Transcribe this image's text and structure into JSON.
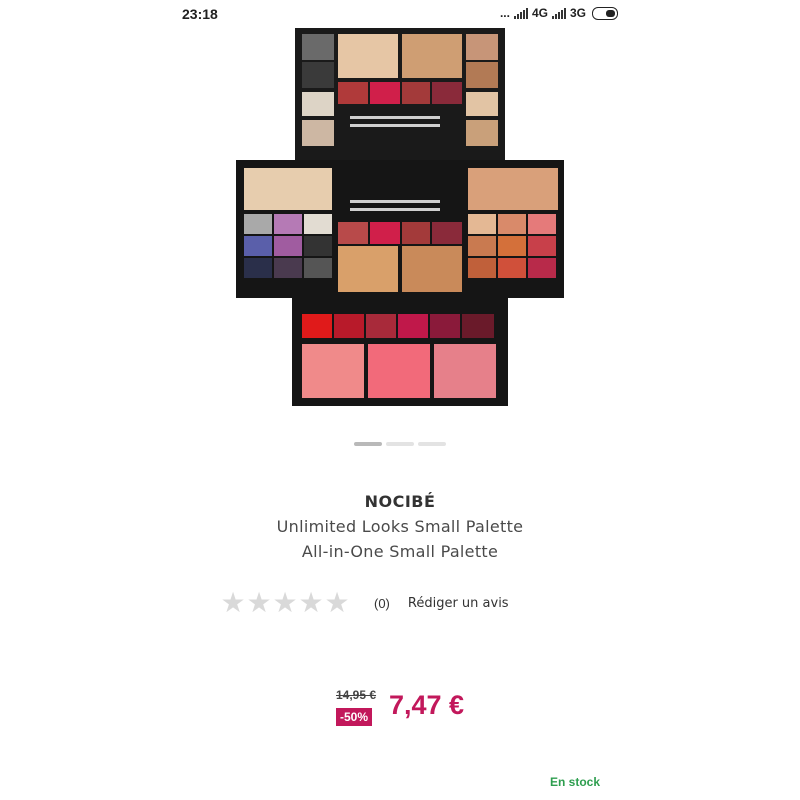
{
  "status_bar": {
    "time": "23:18",
    "dots": "...",
    "network_1": "4G",
    "network_2": "3G"
  },
  "product": {
    "image_icon": "makeup-palette-image",
    "brand": "NOCIBÉ",
    "name_line1": "Unlimited Looks Small Palette",
    "name_line2": "All-in-One Small Palette",
    "carousel": {
      "total": 3,
      "active": 1
    }
  },
  "rating": {
    "stars_filled": 0,
    "stars_total": 5,
    "count": "(0)",
    "write_review": "Rédiger un avis"
  },
  "pricing": {
    "old_price": "14,95 €",
    "discount": "-50%",
    "price": "7,47 €"
  },
  "availability": "En stock",
  "colors": {
    "accent": "#c2185b",
    "in_stock": "#2e9e4f",
    "star_empty": "#d9d9d9"
  }
}
